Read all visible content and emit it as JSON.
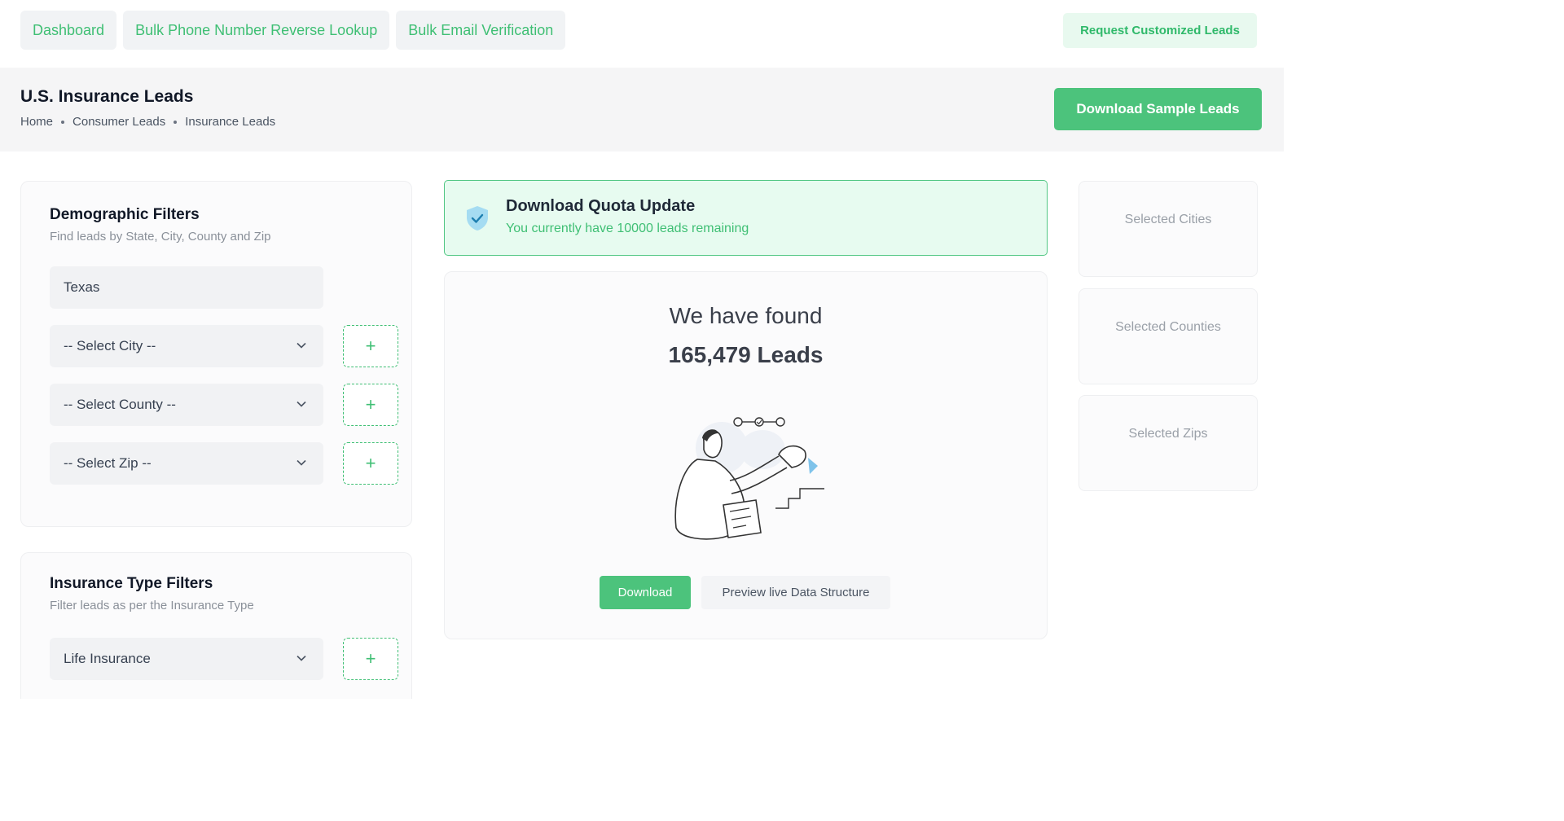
{
  "topnav": {
    "items": [
      "Dashboard",
      "Bulk Phone Number Reverse Lookup",
      "Bulk Email Verification"
    ],
    "request_label": "Request Customized Leads"
  },
  "header": {
    "title": "U.S. Insurance Leads",
    "breadcrumb": [
      "Home",
      "Consumer Leads",
      "Insurance Leads"
    ],
    "download_sample_label": "Download Sample Leads"
  },
  "demographic": {
    "title": "Demographic Filters",
    "subtitle": "Find leads by State, City, County and Zip",
    "state_value": "Texas",
    "city_select": "-- Select City --",
    "county_select": "-- Select County --",
    "zip_select": "-- Select Zip --",
    "add_label": "+"
  },
  "insurance": {
    "title": "Insurance Type Filters",
    "subtitle": "Filter leads as per the Insurance Type",
    "type_select": "Life Insurance",
    "add_label": "+"
  },
  "quota": {
    "title": "Download Quota Update",
    "message": "You currently have 10000 leads remaining"
  },
  "results": {
    "heading": "We have found",
    "count_text": "165,479 Leads",
    "download_label": "Download",
    "preview_label": "Preview live Data Structure"
  },
  "selected": {
    "cities": "Selected Cities",
    "counties": "Selected Counties",
    "zips": "Selected Zips"
  },
  "colors": {
    "accent": "#4cc37c",
    "accent_text": "#3fbf74",
    "quota_bg": "#e7fbf0"
  },
  "icons": [
    "shield-check-icon",
    "chevron-down-icon",
    "plus-icon"
  ]
}
